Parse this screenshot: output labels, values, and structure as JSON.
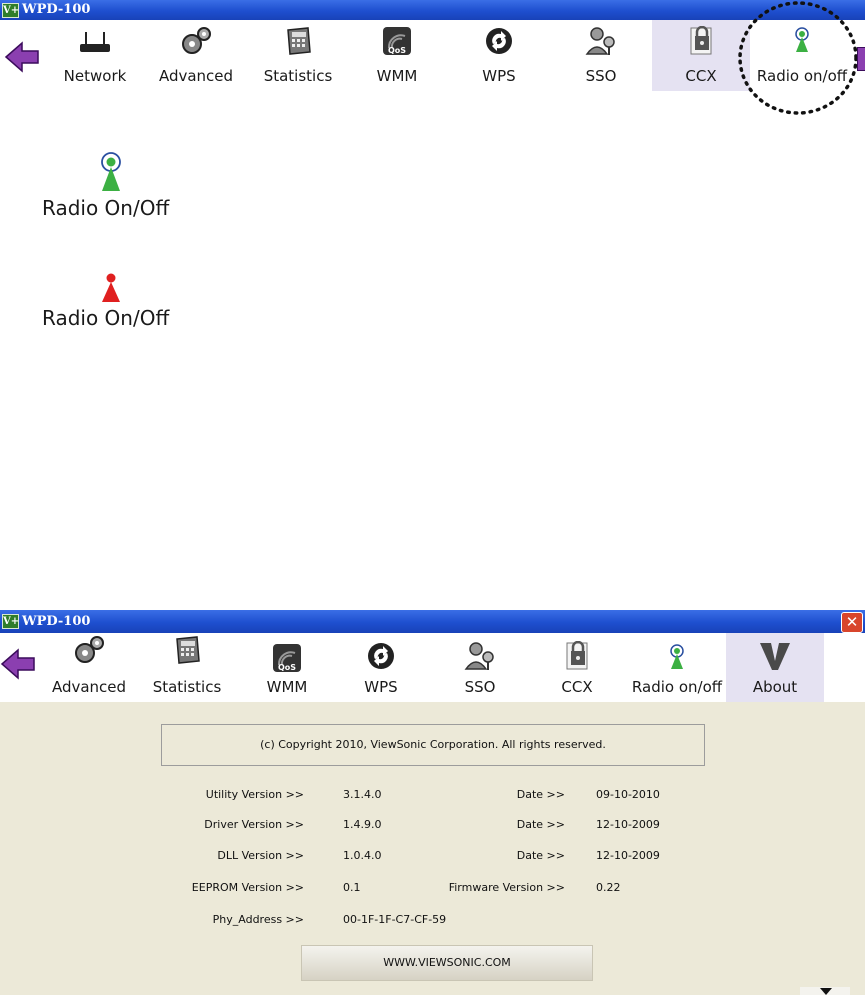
{
  "window_title": "WPD-100",
  "title_logo": "V+",
  "top_toolbar": {
    "items": [
      {
        "label": "Network",
        "icon": "router-icon"
      },
      {
        "label": "Advanced",
        "icon": "gears-icon"
      },
      {
        "label": "Statistics",
        "icon": "calculator-icon"
      },
      {
        "label": "WMM",
        "icon": "qos-icon"
      },
      {
        "label": "WPS",
        "icon": "wps-icon"
      },
      {
        "label": "SSO",
        "icon": "sso-key-icon"
      },
      {
        "label": "CCX",
        "icon": "ccx-lock-icon"
      },
      {
        "label": "Radio on/off",
        "icon": "radio-antenna-icon"
      }
    ],
    "active": "CCX"
  },
  "radio_on": {
    "label": "Radio On/Off",
    "state_color": "#3cb043"
  },
  "radio_off": {
    "label": "Radio On/Off",
    "state_color": "#e02020"
  },
  "bottom_toolbar": {
    "items": [
      {
        "label": "Advanced",
        "icon": "gears-icon"
      },
      {
        "label": "Statistics",
        "icon": "calculator-icon"
      },
      {
        "label": "WMM",
        "icon": "qos-icon"
      },
      {
        "label": "WPS",
        "icon": "wps-icon"
      },
      {
        "label": "SSO",
        "icon": "sso-key-icon"
      },
      {
        "label": "CCX",
        "icon": "ccx-lock-icon"
      },
      {
        "label": "Radio on/off",
        "icon": "radio-antenna-icon"
      },
      {
        "label": "About",
        "icon": "viewsonic-v-icon"
      }
    ],
    "active": "About"
  },
  "about": {
    "copyright": "(c) Copyright 2010, ViewSonic Corporation. All rights reserved.",
    "utility_label": "Utility Version >>",
    "utility_value": "3.1.4.0",
    "driver_label": "Driver Version >>",
    "driver_value": "1.4.9.0",
    "dll_label": "DLL Version >>",
    "dll_value": "1.0.4.0",
    "eeprom_label": "EEPROM Version >>",
    "eeprom_value": "0.1",
    "phy_label": "Phy_Address >>",
    "phy_value": "00-1F-1F-C7-CF-59",
    "date_label": "Date >>",
    "utility_date": "09-10-2010",
    "driver_date": "12-10-2009",
    "dll_date": "12-10-2009",
    "firmware_label": "Firmware Version >>",
    "firmware_value": "0.22",
    "website_button": "WWW.VIEWSONIC.COM"
  },
  "close_symbol": "✕"
}
